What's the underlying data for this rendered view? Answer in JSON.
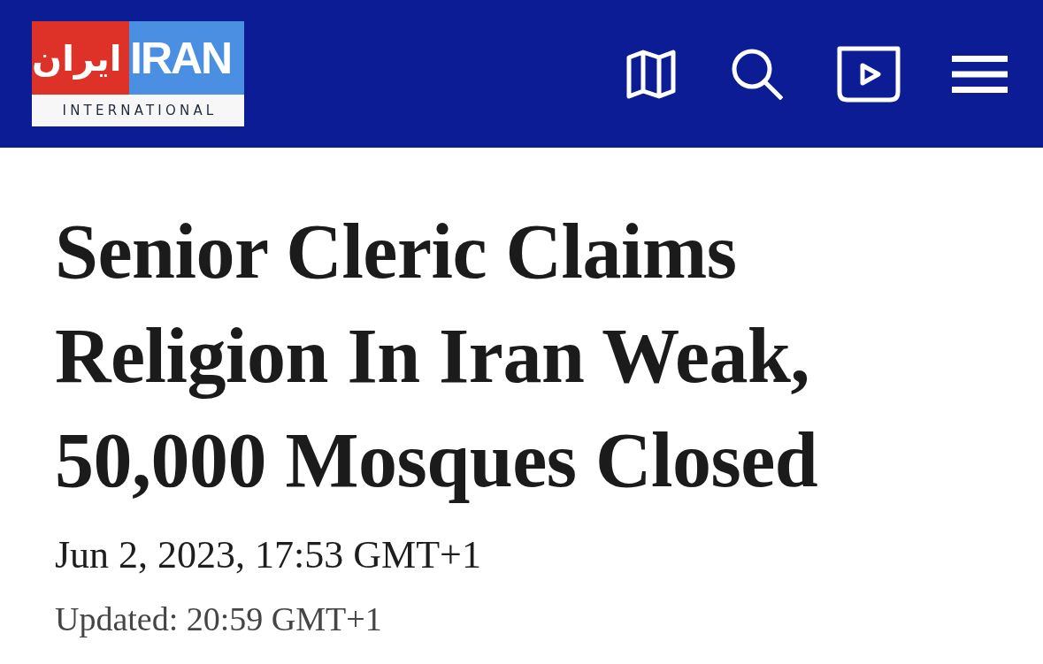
{
  "header": {
    "logo": {
      "arabic": "ایران",
      "latin": "IRAN",
      "subtitle": "INTERNATIONAL"
    }
  },
  "article": {
    "headline": "Senior Cleric Claims Religion In Iran Weak, 50,000 Mosques Closed",
    "published": "Jun 2, 2023, 17:53 GMT+1",
    "updated": "Updated: 20:59 GMT+1"
  }
}
